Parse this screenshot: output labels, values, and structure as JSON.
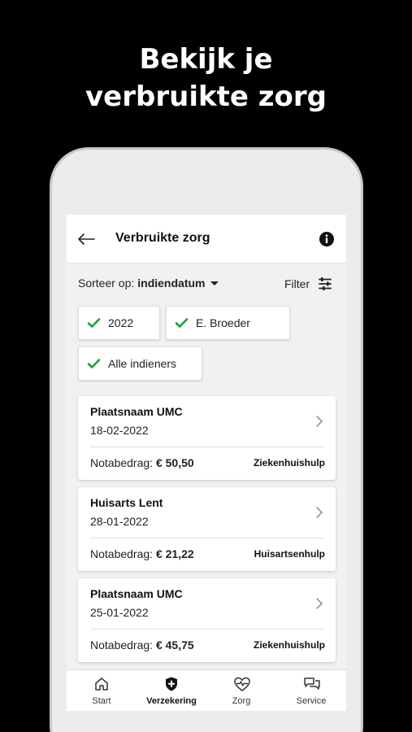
{
  "promo": {
    "line1": "Bekijk je",
    "line2": "verbruikte zorg"
  },
  "appbar": {
    "title": "Verbruikte zorg"
  },
  "sort": {
    "label": "Sorteer op:",
    "value": "indiendatum"
  },
  "filter": {
    "label": "Filter"
  },
  "chips": [
    {
      "label": "2022",
      "checked": true
    },
    {
      "label": "E. Broeder",
      "checked": true
    },
    {
      "label": "Alle indieners",
      "checked": true
    }
  ],
  "cards": [
    {
      "name": "Plaatsnaam UMC",
      "date": "18-02-2022",
      "amount_label": "Notabedrag:",
      "amount": "€ 50,50",
      "category": "Ziekenhuishulp"
    },
    {
      "name": "Huisarts Lent",
      "date": "28-01-2022",
      "amount_label": "Notabedrag:",
      "amount": "€ 21,22",
      "category": "Huisartsenhulp"
    },
    {
      "name": "Plaatsnaam UMC",
      "date": "25-01-2022",
      "amount_label": "Notabedrag:",
      "amount": "€ 45,75",
      "category": "Ziekenhuishulp"
    }
  ],
  "nav": [
    {
      "label": "Start",
      "icon": "home-icon",
      "active": false
    },
    {
      "label": "Verzekering",
      "icon": "shield-plus-icon",
      "active": true
    },
    {
      "label": "Zorg",
      "icon": "heart-pulse-icon",
      "active": false
    },
    {
      "label": "Service",
      "icon": "chat-bubbles-icon",
      "active": false
    }
  ],
  "colors": {
    "check": "#1e9e3a",
    "background": "#000000",
    "screen": "#f1f1f1"
  }
}
